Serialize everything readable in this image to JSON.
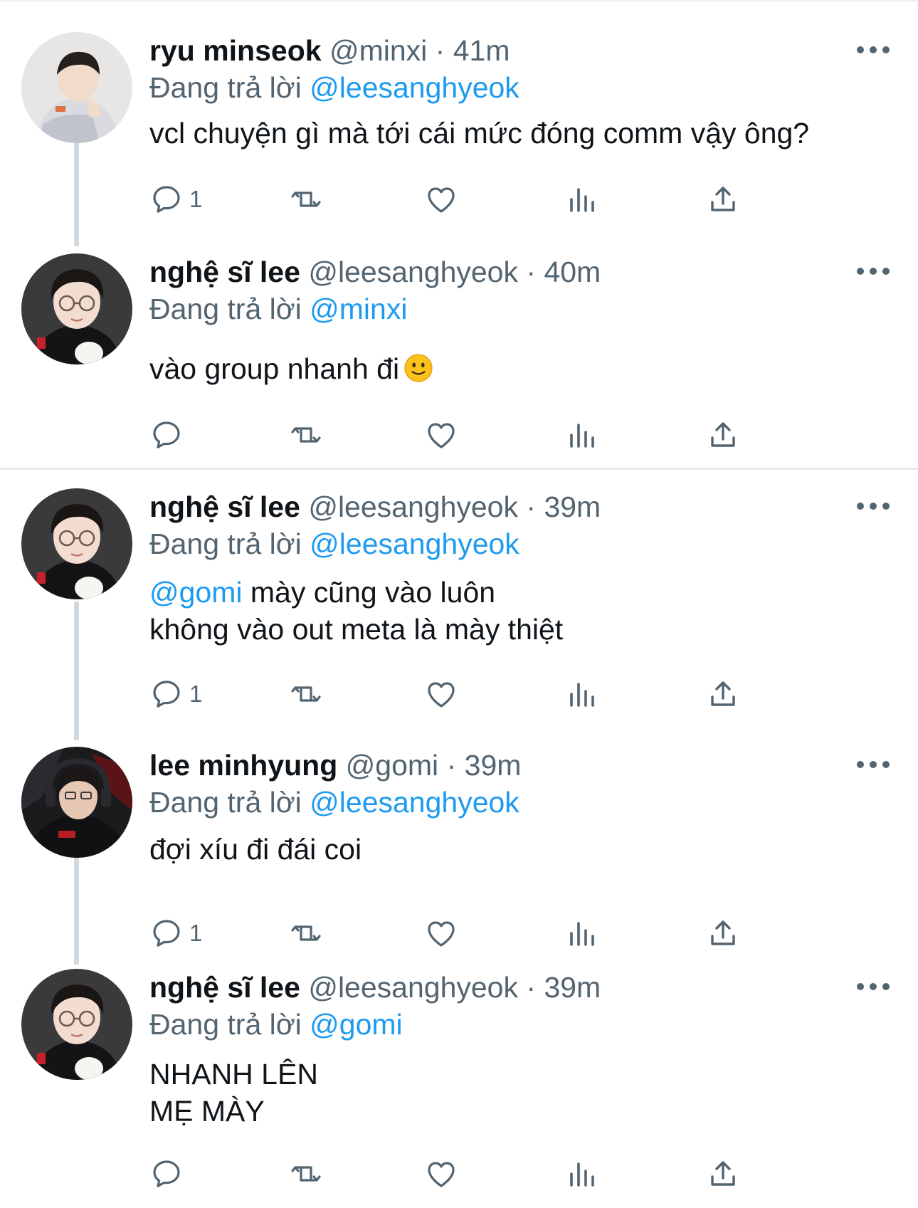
{
  "tweets": [
    {
      "name": "ryu minseok",
      "handle": "@minxi",
      "sep": "·",
      "time": "41m",
      "reply_prefix": "Đang trả lời",
      "reply_to": "@leesanghyeok",
      "lines": [
        "vcl chuyện gì mà tới cái mức đóng comm vậy ông?"
      ],
      "reply_count": "1"
    },
    {
      "name": "nghệ sĩ lee",
      "handle": "@leesanghyeok",
      "sep": "·",
      "time": "40m",
      "reply_prefix": "Đang trả lời",
      "reply_to": "@minxi",
      "lines": [
        "vào group nhanh đi"
      ],
      "emoji": "slightly-smiling-face",
      "reply_count": ""
    },
    {
      "name": "nghệ sĩ lee",
      "handle": "@leesanghyeok",
      "sep": "·",
      "time": "39m",
      "reply_prefix": "Đang trả lời",
      "reply_to": "@leesanghyeok",
      "line1_mention": "@gomi",
      "lines": [
        " mày cũng vào luôn",
        "không vào out meta là mày thiệt"
      ],
      "reply_count": "1"
    },
    {
      "name": "lee minhyung",
      "handle": "@gomi",
      "sep": "·",
      "time": "39m",
      "reply_prefix": "Đang trả lời",
      "reply_to": "@leesanghyeok",
      "lines": [
        "đợi xíu đi đái coi"
      ],
      "reply_count": "1"
    },
    {
      "name": "nghệ sĩ lee",
      "handle": "@leesanghyeok",
      "sep": "·",
      "time": "39m",
      "reply_prefix": "Đang trả lời",
      "reply_to": "@gomi",
      "lines": [
        "NHANH LÊN",
        "MẸ MÀY"
      ],
      "reply_count": ""
    }
  ],
  "icons": {
    "reply": "speech-bubble-icon",
    "retweet": "retweet-icon",
    "like": "heart-icon",
    "views": "bar-chart-icon",
    "share": "share-icon",
    "more": "more-dots-icon"
  },
  "colors": {
    "mention": "#1d9bf0",
    "secondary_text": "#536471",
    "primary_text": "#0f1419",
    "thread_line": "#cfd9de"
  }
}
